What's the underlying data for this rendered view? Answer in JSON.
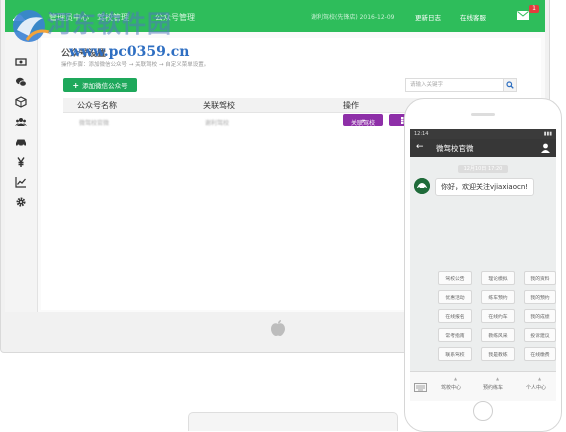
{
  "watermark": {
    "title": "河东软件园",
    "url": "www.pc0359.cn"
  },
  "topbar": {
    "nav_a": "管理员中心",
    "nav_b": "驾校管理",
    "nav_c": "公众号管理",
    "user_info": "谢利驾校(先锋店)  2016-12-09",
    "changelog": "更新日志",
    "online_service": "在线客服",
    "mail_badge": "1"
  },
  "sidebar": {
    "icons": [
      "money-icon",
      "wechat-icon",
      "box-icon",
      "users-icon",
      "car-icon",
      "yen-icon",
      "trend-icon",
      "gear-icon"
    ]
  },
  "content": {
    "title": "公众号设置",
    "hint": "操作步骤：添加微信公众号  →  关联驾校  →  自定义菜单设置。",
    "add_button": "添加微信公众号",
    "search_placeholder": "请输入关键字",
    "table": {
      "headers": [
        "公众号名称",
        "关联驾校",
        "操作"
      ],
      "rows": [
        {
          "name": "微驾校官微",
          "school": "谢利驾校",
          "action": "关联驾校"
        }
      ]
    }
  },
  "phone": {
    "time": "12:14",
    "chat_title": "微驾校官微",
    "msg_time": "12月10日 17:20",
    "welcome": "你好，欢迎关注vjiaxiaocn!",
    "menu": [
      [
        "驾校公告",
        "理论模拟",
        "我的资料"
      ],
      [
        "优惠活动",
        "练车预约",
        "我的预约"
      ],
      [
        "在线报名",
        "在线约车",
        "我的成绩"
      ],
      [
        "常考指南",
        "教练风采",
        "投诉建议"
      ],
      [
        "联系驾校",
        "我是教练",
        "在线缴费"
      ]
    ],
    "tabs": [
      "驾校中心",
      "预约练车",
      "个人中心"
    ]
  }
}
